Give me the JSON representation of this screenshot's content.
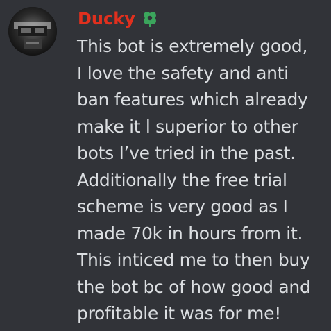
{
  "message": {
    "author": {
      "name": "Ducky",
      "name_color": "#e0301e",
      "avatar": "user-avatar",
      "role_icon": "leaf-clover-icon",
      "role_icon_color": "#3ba55c"
    },
    "text_lines": [
      "This bot is extremely good,",
      "I love the safety and anti",
      "ban features which already",
      "make it l superior to other",
      "bots I’ve tried in the past.",
      "Additionally the free trial",
      "scheme is very good as I",
      "made 70k in hours from it.",
      "This inticed me to then buy",
      "the bot bc of how good and",
      "profitable it was for me!"
    ]
  },
  "theme": {
    "background": "#313338",
    "text_color": "#dbdee1"
  }
}
